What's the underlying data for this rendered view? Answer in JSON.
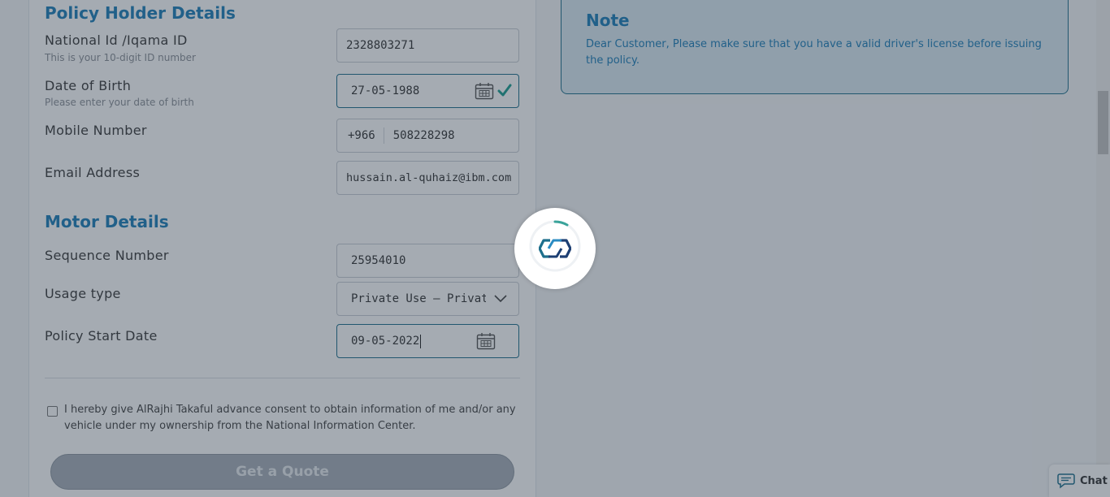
{
  "policy_holder": {
    "section_title": "Policy Holder Details",
    "national_id": {
      "label": "National Id /Iqama ID",
      "hint": "This is your 10-digit ID number",
      "value": "2328803271"
    },
    "dob": {
      "label": "Date of Birth",
      "hint": "Please enter your date of birth",
      "value": "27-05-1988"
    },
    "mobile": {
      "label": "Mobile Number",
      "prefix": "+966",
      "value": "508228298"
    },
    "email": {
      "label": "Email Address",
      "value": "hussain.al-quhaiz@ibm.com"
    }
  },
  "motor": {
    "section_title": "Motor Details",
    "sequence": {
      "label": "Sequence Number",
      "value": "25954010"
    },
    "usage": {
      "label": "Usage type",
      "value": "Private Use – Private Ve"
    },
    "start_date": {
      "label": "Policy Start Date",
      "value": "09-05-2022"
    }
  },
  "consent_text": "I hereby give AlRajhi Takaful advance consent to obtain information of me and/or any vehicle under my ownership from the National Information Center.",
  "quote_button": "Get a Quote",
  "note": {
    "title": "Note",
    "text": "Dear Customer, Please make sure that you have a valid driver's license before issuing the policy."
  },
  "chat_label": "Chat",
  "colors": {
    "accent": "#1d7eb8",
    "focus_border": "#1d6f8c",
    "check": "#1a9e8f",
    "overlay": "#283748"
  },
  "icons": [
    "calendar-icon",
    "check-icon",
    "chevron-down-icon",
    "chat-icon",
    "loading-spinner",
    "brand-logo-icon"
  ]
}
